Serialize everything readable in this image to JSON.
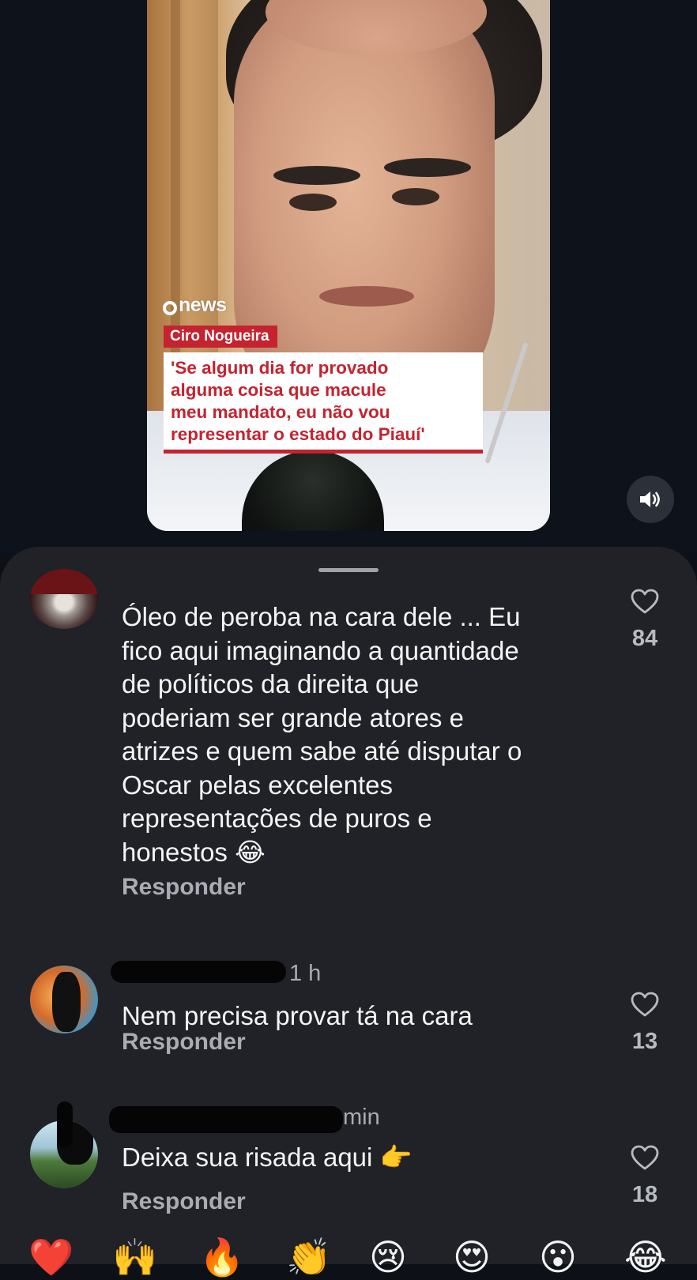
{
  "video": {
    "brand": "news",
    "name_tag": "Ciro Nogueira",
    "quote_lines": [
      "'Se algum dia for provado",
      "alguma coisa que macule",
      "meu mandato, eu não vou",
      "representar o estado do Piauí'"
    ],
    "sound_icon": "volume-icon"
  },
  "comments": [
    {
      "text_lines": [
        "Óleo de peroba na cara dele ... Eu",
        "fico aqui imaginando a quantidade",
        "de políticos da direita que",
        "poderiam ser grande atores e",
        "atrizes e quem sabe até disputar o",
        "Oscar pelas excelentes",
        "representações de puros e",
        "honestos 😂"
      ],
      "reply": "Responder",
      "likes": "84"
    },
    {
      "time": "1 h",
      "text": "Nem precisa provar tá na cara",
      "reply": "Responder",
      "likes": "13"
    },
    {
      "time": "min",
      "text": "Deixa sua risada aqui 👉",
      "reply": "Responder",
      "likes": "18"
    }
  ],
  "emoji_bar": [
    "❤️",
    "🙌",
    "🔥",
    "👏",
    "😢",
    "😍",
    "😮",
    "😂"
  ]
}
